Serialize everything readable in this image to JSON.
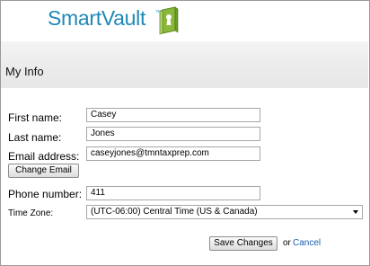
{
  "brand": {
    "name": "SmartVault",
    "trademark": "™",
    "color": "#1f88b7",
    "icon": "book-keyhole-icon"
  },
  "page": {
    "title": "My Info"
  },
  "form": {
    "first_name": {
      "label": "First name:",
      "value": "Casey"
    },
    "last_name": {
      "label": "Last name:",
      "value": "Jones"
    },
    "email": {
      "label": "Email address:",
      "value": "caseyjones@tmntaxprep.com"
    },
    "change_email_label": "Change Email",
    "phone": {
      "label": "Phone number:",
      "value": "411"
    },
    "time_zone": {
      "label": "Time Zone:",
      "selected": "(UTC-06:00) Central Time (US & Canada)"
    }
  },
  "actions": {
    "save_label": "Save Changes",
    "or_text": "or",
    "cancel_label": "Cancel",
    "link_color": "#1a5fb4"
  }
}
